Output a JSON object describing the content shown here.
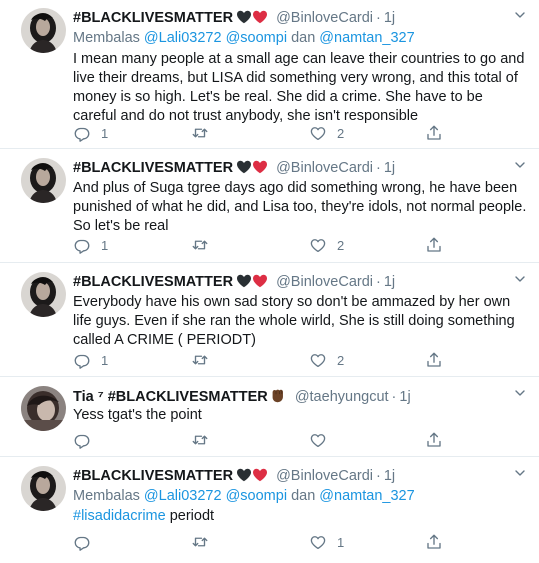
{
  "colors": {
    "link": "#1b95e0",
    "secondary": "#657786",
    "border": "#e6ecf0"
  },
  "tweets": [
    {
      "name": "#BLACKLIVESMATTER",
      "emoji": [
        "black-heart-icon",
        "red-heart-icon"
      ],
      "handle": "@BinloveCardi",
      "dot": "·",
      "time": "1j",
      "reply_prefix": "Membalas ",
      "reply_user1": "@Lali03272",
      "reply_user2": "@soompi",
      "reply_and": " dan ",
      "reply_user3": "@namtan_327",
      "text": "I mean many people at a small age can leave their countries to go and live their dreams, but LISA did something very wrong, and this total of money is so high. Let's be real. She did a crime. She have to be careful and do not trust anybody, she isn't responsible",
      "replies": "1",
      "retweets": "",
      "likes": "2"
    },
    {
      "name": "#BLACKLIVESMATTER",
      "emoji": [
        "black-heart-icon",
        "red-heart-icon"
      ],
      "handle": "@BinloveCardi",
      "dot": "·",
      "time": "1j",
      "text": "And plus of Suga tgree days ago did something wrong, he have been punished of what he did, and Lisa too, they're idols, not normal people. So let's be real",
      "replies": "1",
      "retweets": "",
      "likes": "2"
    },
    {
      "name": "#BLACKLIVESMATTER",
      "emoji": [
        "black-heart-icon",
        "red-heart-icon"
      ],
      "handle": "@BinloveCardi",
      "dot": "·",
      "time": "1j",
      "text": "Everybody have his own sad story so don't be ammazed by her own life guys. Even if she ran the whole wirld, She is still doing something called A CRIME ( PERIODT)",
      "replies": "1",
      "retweets": "",
      "likes": "2"
    },
    {
      "name": "Tia ⁷ #BLACKLIVESMATTER",
      "emoji": [
        "raised-fist-icon"
      ],
      "handle": "@taehyungcut",
      "dot": "·",
      "time": "1j",
      "text": "Yess tgat's the point",
      "replies": "",
      "retweets": "",
      "likes": ""
    },
    {
      "name": "#BLACKLIVESMATTER",
      "emoji": [
        "black-heart-icon",
        "red-heart-icon"
      ],
      "handle": "@BinloveCardi",
      "dot": "·",
      "time": "1j",
      "reply_prefix": "Membalas ",
      "reply_user1": "@Lali03272",
      "reply_user2": "@soompi",
      "reply_and": " dan ",
      "reply_user3": "@namtan_327",
      "hashtag": "#lisadidacrime",
      "text_after": " periodt",
      "replies": "",
      "retweets": "",
      "likes": "1"
    }
  ]
}
